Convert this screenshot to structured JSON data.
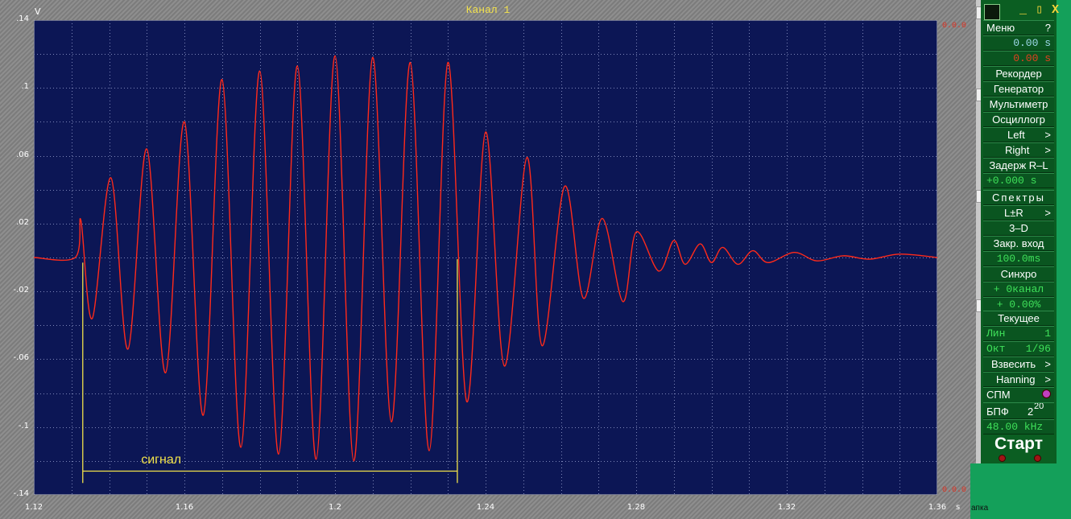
{
  "scope": {
    "title": "Канал 1",
    "y_unit": "V",
    "x_unit": "s",
    "top_right_marker": "0.0.0",
    "bottom_right_marker": "0.0.0"
  },
  "chart_data": {
    "type": "line",
    "xlim": [
      1.12,
      1.36
    ],
    "ylim": [
      -0.14,
      0.14
    ],
    "x_ticks": [
      "1.12",
      "1.16",
      "1.2",
      "1.24",
      "1.28",
      "1.32",
      "1.36"
    ],
    "y_ticks": [
      ".14",
      ".1",
      ".06",
      ".02",
      "-.02",
      "-.06",
      "-.1",
      "-.14"
    ],
    "grid": true,
    "series": [
      {
        "color": "#ff2a1a",
        "x": [
          1.12,
          1.131,
          1.1325,
          1.1355,
          1.1405,
          1.145,
          1.15,
          1.155,
          1.16,
          1.165,
          1.17,
          1.175,
          1.18,
          1.185,
          1.19,
          1.195,
          1.2,
          1.205,
          1.21,
          1.215,
          1.22,
          1.225,
          1.23,
          1.235,
          1.24,
          1.245,
          1.251,
          1.255,
          1.261,
          1.266,
          1.271,
          1.2765,
          1.28,
          1.286,
          1.29,
          1.293,
          1.297,
          1.3,
          1.303,
          1.307,
          1.311,
          1.315,
          1.322,
          1.328,
          1.335,
          1.342,
          1.35,
          1.36
        ],
        "y": [
          0.0,
          0.0,
          0.022,
          -0.036,
          0.047,
          -0.054,
          0.064,
          -0.068,
          0.08,
          -0.093,
          0.105,
          -0.112,
          0.11,
          -0.116,
          0.113,
          -0.119,
          0.119,
          -0.12,
          0.118,
          -0.097,
          0.115,
          -0.114,
          0.115,
          -0.085,
          0.074,
          -0.064,
          0.059,
          -0.052,
          0.042,
          -0.024,
          0.023,
          -0.026,
          0.015,
          -0.008,
          0.01,
          -0.004,
          0.008,
          -0.003,
          0.006,
          -0.004,
          0.004,
          -0.003,
          0.003,
          -0.002,
          0.001,
          -0.001,
          0.002,
          0.0
        ]
      }
    ],
    "annotations": [
      {
        "text": "сигнал",
        "color": "#f2e24a",
        "x_from": 1.133,
        "x_to": 1.2325
      }
    ]
  },
  "panel": {
    "menu_label": "Меню",
    "help_label": "?",
    "time_green": "0.00 s",
    "time_red": "0.00 s",
    "recorder": "Рекордер",
    "generator": "Генератор",
    "multimeter": "Мультиметр",
    "oscilloscope": "Осциллогр",
    "left": "Left",
    "right": "Right",
    "arrow": ">",
    "delay_label": "Задерж R–L",
    "delay_value": "+0.000 s",
    "spectra": "Спектры",
    "lr": "L±R",
    "three_d": "3–D",
    "close_input": "Закр. вход",
    "close_value": "100.0ms",
    "sync": "Синхро",
    "sync_channel": "+ 0канал",
    "sync_percent": "+ 0.00%",
    "current": "Текущее",
    "lin_label": "Лин",
    "lin_value": "1",
    "oct_label": "Окт",
    "oct_value": "1/96",
    "weigh": "Взвесить",
    "window": "Hanning",
    "spm": "СПМ",
    "fft_label": "БПФ",
    "fft_base": "2",
    "fft_exp": "20",
    "sample_rate": "48.00 kHz",
    "start": "Старт",
    "window_controls": "_ ▯ X"
  },
  "desktop": {
    "folder_label": "апка"
  }
}
